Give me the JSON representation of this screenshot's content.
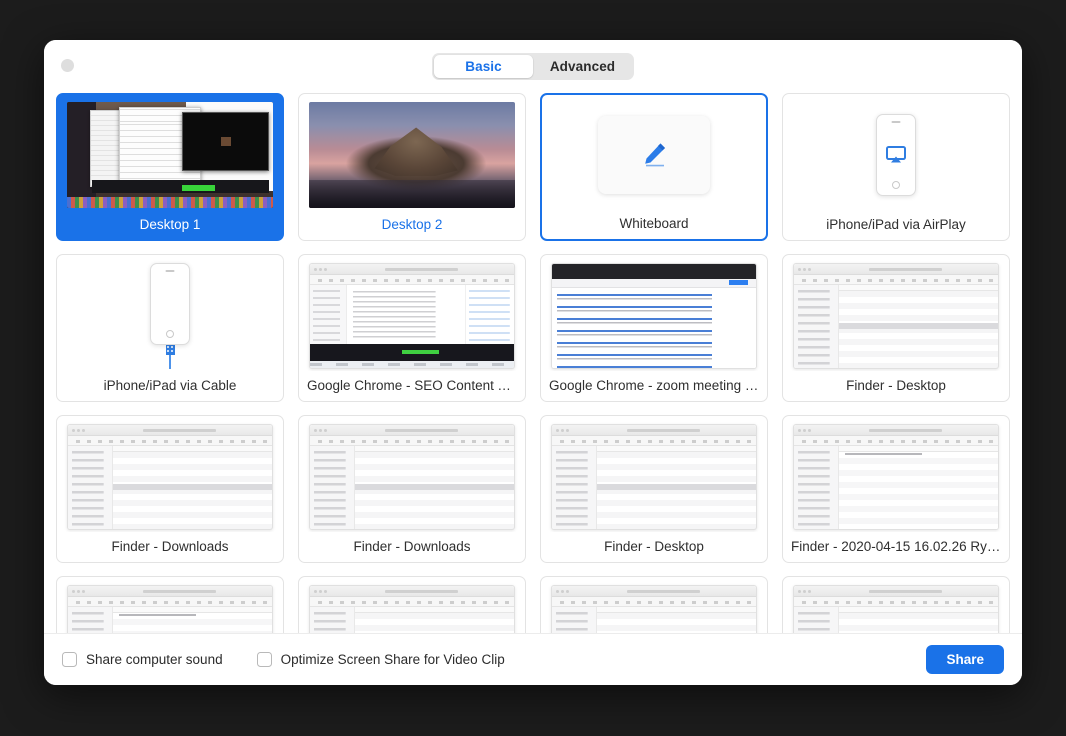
{
  "window": {
    "close_button": "close-button"
  },
  "tabs": {
    "items": [
      {
        "label": "Basic",
        "active": true
      },
      {
        "label": "Advanced",
        "active": false
      }
    ]
  },
  "sources": [
    {
      "label": "Desktop 1",
      "state": "selected",
      "thumb": "desktop1"
    },
    {
      "label": "Desktop 2",
      "state": "accent-label",
      "thumb": "catalina"
    },
    {
      "label": "Whiteboard",
      "state": "hovered",
      "thumb": "whiteboard"
    },
    {
      "label": "iPhone/iPad via AirPlay",
      "state": "normal",
      "thumb": "airplay"
    },
    {
      "label": "iPhone/iPad via Cable",
      "state": "normal",
      "thumb": "cable"
    },
    {
      "label": "Google Chrome - SEO Content Te…",
      "state": "normal",
      "thumb": "chrome-doc"
    },
    {
      "label": "Google Chrome - zoom meeting ro…",
      "state": "normal",
      "thumb": "chrome-search"
    },
    {
      "label": "Finder - Desktop",
      "state": "normal",
      "thumb": "finder"
    },
    {
      "label": "Finder - Downloads",
      "state": "normal",
      "thumb": "finder"
    },
    {
      "label": "Finder - Downloads",
      "state": "normal",
      "thumb": "finder"
    },
    {
      "label": "Finder - Desktop",
      "state": "normal",
      "thumb": "finder"
    },
    {
      "label": "Finder - 2020-04-15 16.02.26 Rya…",
      "state": "normal",
      "thumb": "finder-empty"
    },
    {
      "label": "",
      "state": "partial",
      "thumb": "finder-empty"
    },
    {
      "label": "",
      "state": "partial",
      "thumb": "finder"
    },
    {
      "label": "",
      "state": "partial",
      "thumb": "finder"
    },
    {
      "label": "",
      "state": "partial",
      "thumb": "finder"
    }
  ],
  "footer": {
    "share_computer_sound": "Share computer sound",
    "optimize_video_clip": "Optimize Screen Share for Video Clip",
    "share_button": "Share"
  },
  "colors": {
    "accent": "#1a72e8",
    "selected_tile": "#1a72e8",
    "tab_active_text": "#1b72e8",
    "dialog_background": "#ffffff",
    "page_background": "#1c1c1c"
  }
}
